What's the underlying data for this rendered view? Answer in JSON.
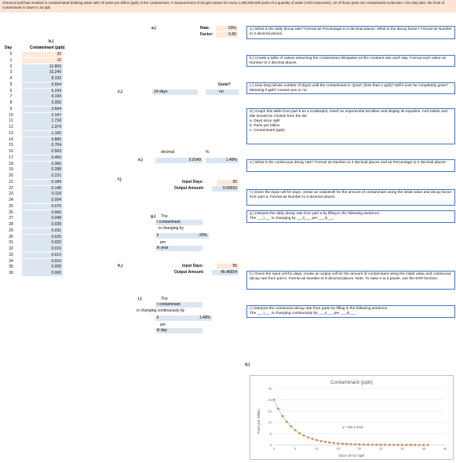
{
  "banner": {
    "text": "chemical spill has resulted in contaminated drinking water with 20 parts per billion (ppb) of the contaminant. A measurement of 20 ppb means for every 1,000,000,000 parts of a quantity of water (H2O molecules), 20 of those parts are contaminant molecules. One day later, the level of contaminant is down to 16 ppb."
  },
  "table": {
    "b_label": "b.)",
    "day_header": "Day",
    "contaminant_header": "Contaminant (ppb)",
    "days": [
      "0",
      "1",
      "2",
      "3",
      "4",
      "5",
      "6",
      "7",
      "8",
      "9",
      "10",
      "11",
      "12",
      "13",
      "14",
      "15",
      "16",
      "17",
      "18",
      "19",
      "20",
      "21",
      "22",
      "23",
      "24",
      "25",
      "26",
      "27",
      "28",
      "29",
      "30",
      "31",
      "32",
      "33",
      "34",
      "35",
      "36"
    ],
    "values": [
      "20",
      "16",
      "12.800",
      "10.240",
      "8.192",
      "6.554",
      "5.243",
      "4.194",
      "3.355",
      "2.684",
      "2.147",
      "1.718",
      "1.374",
      "1.100",
      "0.880",
      "0.704",
      "0.563",
      "0.450",
      "0.360",
      "0.288",
      "0.231",
      "0.184",
      "0.148",
      "0.118",
      "0.094",
      "0.076",
      "0.060",
      "0.048",
      "0.039",
      "0.031",
      "0.025",
      "0.020",
      "0.016",
      "0.013",
      "0.010",
      "0.008",
      "0.006"
    ]
  },
  "part_a": {
    "label": "a.)",
    "rate_label": "Rate:",
    "rate_value": "-20%",
    "factor_label": "Factor:",
    "factor_value": "0.80"
  },
  "part_c": {
    "label": "c.)",
    "days_value": "14",
    "days_unit": "days",
    "gone_label": "Gone?",
    "gone_value": "no"
  },
  "part_e": {
    "label": "e.)",
    "decimal_label": "decimal",
    "percent_label": "%",
    "decimal_value": "0.0149",
    "percent_value": "1.49%"
  },
  "part_f": {
    "label": "f.)",
    "input_days_label": "Input Days:",
    "input_days_value": "55",
    "output_label": "Output Amount:",
    "output_value": "0.00033"
  },
  "part_g": {
    "label": "g.)",
    "line1": "The",
    "line2": "i  contaminant",
    "line3": "is changing by",
    "blank": "ii",
    "rate": "-20%",
    "per_label": "per",
    "per_value": "iii  year"
  },
  "part_h": {
    "label": "h.)",
    "input_days_label": "Input Days:",
    "input_days_value": "55",
    "output_label": "Output Amount:",
    "output_value": "45.46654"
  },
  "part_i": {
    "label": "i.)",
    "line1": "The",
    "line2": "i  contaminant",
    "line3": "is changing continuously by",
    "blank": "ii",
    "rate": "1.49%",
    "per_label": "per",
    "per_value": "iii  day"
  },
  "part_d_label": "d.)",
  "questions": {
    "a": "a.)  What is the daily decay rate? Format as Percentage to 0 decimal places. What is the decay factor? Format as Number to 2 decimal places.",
    "b": "b.)  Create a table of values assuming the contaminant dissipates at this constant rate each day. Format each value as Number to 3 decimal places.",
    "c": "c.)  How long (whole number of days) until the contaminant is \"gone\" (less than 1 ppb)? Will it ever be completely gone? Meaning 0 ppb? Answer yes or no.",
    "d": "d.)  Graph this table from part b as a scatterplot, insert an exponential trendline and display its equation. Axis labels and title should be chosen from the list:\na. Days since spill\nb. Parts per billion\nc. Contaminant (ppb)",
    "e": "e.)  What is the continuous decay rate? Format as Number to 4 decimal places and as Percentage to 2 decimal places.",
    "f": "f.)  Given the input cell for days, create an outputcell for the amount of contaminant using the initial value and decay factor from part a. Format as Number to 5 decimal places.",
    "g": "g.)  Interpret the daily decay rate from part a by filling in the following sentence:\nThe ___i___ is changing by ___ii___ per ___iii___.",
    "h": "h.)  Given the input cell for days, create an output cell for the amount of contaminant using the initial value and continuous decay rate from part e. Format as Number to 5 decimal places. Note: To raise e to a power, use the EXP function.",
    "i": "i.)  Interpret the continuous decay rate from parte by filling in the following sentence:\nThe ___i___ is changing continuously by ___ii___ per ___iii___."
  },
  "chart_data": {
    "type": "scatter",
    "title": "Contaminant (ppb)",
    "xlabel": "Days Since Spill",
    "ylabel": "Parts per Billion",
    "xlim": [
      0,
      40
    ],
    "ylim": [
      0,
      25
    ],
    "xticks": [
      "0",
      "5",
      "10",
      "15",
      "20",
      "25",
      "30",
      "35",
      "40"
    ],
    "yticks": [
      "0",
      "5",
      "10",
      "15",
      "20",
      "25"
    ],
    "trendline_label": "y = 20e-0.223x",
    "x": [
      0,
      1,
      2,
      3,
      4,
      5,
      6,
      7,
      8,
      9,
      10,
      11,
      12,
      13,
      14,
      15,
      16,
      17,
      18,
      19,
      20,
      21,
      22,
      23,
      24,
      25,
      26,
      27,
      28,
      29,
      30,
      31,
      32,
      33,
      34,
      35,
      36
    ],
    "y": [
      20,
      16,
      12.8,
      10.24,
      8.192,
      6.554,
      5.243,
      4.194,
      3.355,
      2.684,
      2.147,
      1.718,
      1.374,
      1.1,
      0.88,
      0.704,
      0.563,
      0.45,
      0.36,
      0.288,
      0.231,
      0.184,
      0.148,
      0.118,
      0.094,
      0.076,
      0.06,
      0.048,
      0.039,
      0.031,
      0.025,
      0.02,
      0.016,
      0.013,
      0.01,
      0.008,
      0.006
    ],
    "marker_color": "#ed7d31",
    "trend_color": "#5b9bd5"
  }
}
